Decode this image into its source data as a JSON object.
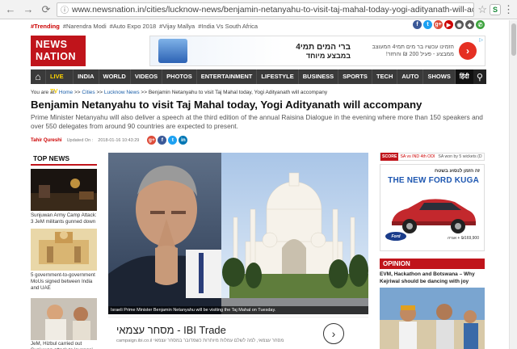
{
  "browser": {
    "url": "www.newsnation.in/cities/lucknow-news/benjamin-netanyahu-to-visit-taj-mahal-today-yogi-adityanath-will-accompany-arti...",
    "ext_label": "S"
  },
  "trending": {
    "label": "#Trending",
    "items": [
      "#Narendra Modi",
      "#Auto Expo 2018",
      "#Vijay Mallya",
      "#India Vs South Africa"
    ]
  },
  "social": [
    {
      "glyph": "f",
      "color": "#3b5998",
      "name": "facebook-icon"
    },
    {
      "glyph": "t",
      "color": "#1da1f2",
      "name": "twitter-icon"
    },
    {
      "glyph": "g+",
      "color": "#dd4b39",
      "name": "google-plus-icon"
    },
    {
      "glyph": "▶",
      "color": "#cc0000",
      "name": "youtube-icon"
    },
    {
      "glyph": "◉",
      "color": "#555555",
      "name": "instagram-icon"
    },
    {
      "glyph": "◆",
      "color": "#5a5a5a",
      "name": "app-icon"
    },
    {
      "glyph": "✆",
      "color": "#3da33d",
      "name": "phone-icon"
    }
  ],
  "logo": {
    "line1": "NEWS",
    "line2": "NATION"
  },
  "top_ad": {
    "headline1": "ברי המים תמי4",
    "headline2": "במבצע מיוחד",
    "mid_text": "הזמינו עכשיו בר מים תמי4 המעוצב ממבצע - פעיל 200 ₪ והחזר!",
    "arrow": "›",
    "mark": "▷"
  },
  "nav": {
    "items": [
      "LIVE TV",
      "INDIA",
      "WORLD",
      "VIDEOS",
      "PHOTOS",
      "ENTERTAINMENT",
      "LIFESTYLE",
      "BUSINESS",
      "SPORTS",
      "TECH",
      "AUTO",
      "SHOWS",
      "हिंदी"
    ]
  },
  "breadcrumb": {
    "prefix": "You are at:",
    "parts": [
      "Home",
      "Cities",
      "Lucknow News",
      "Benjamin Netanyahu to visit Taj Mahal today, Yogi Adityanath will accompany"
    ],
    "sep": ">>"
  },
  "article": {
    "headline": "Benjamin Netanyahu to visit Taj Mahal today, Yogi Adityanath will accompany",
    "summary": "Prime Minister Netanyahu will also deliver a speech at the third edition of the annual Raisina Dialogue in the evening where more than 150 speakers and over 550 delegates from around 90 countries are expected to present.",
    "author": "Tahir Qureshi",
    "updated_label": "Updated On :",
    "updated": "2018-01-16 10:43:29",
    "share": [
      {
        "glyph": "g+",
        "color": "#dd4b39",
        "name": "share-google-plus-icon"
      },
      {
        "glyph": "f",
        "color": "#3b5998",
        "name": "share-facebook-icon"
      },
      {
        "glyph": "t",
        "color": "#1da1f2",
        "name": "share-twitter-icon"
      },
      {
        "glyph": "in",
        "color": "#0077b5",
        "name": "share-linkedin-icon"
      }
    ],
    "hero_caption": "Israeli Prime Minister Benjamin Netanyahu will be visiting the Taj Mahal on Tuesday."
  },
  "top_news": {
    "heading": "TOP NEWS",
    "items": [
      "Sunjuwan Army Camp Attack: 3 JeM militants gunned down",
      "5 government-to-government MoUs signed between India and UAE",
      "JeM, Hizbul carried out Sunjuwan attack to 'avenge'"
    ]
  },
  "ibi_ad": {
    "title": "מסחר עצמאי - IBI Trade",
    "sub": "campaign.ibi.co.il  מסחר עצמאי, למה לשלם עמלות מיותרות כשמדובר במסחר עצמאי",
    "arrow": "›"
  },
  "score": {
    "tag": "SCORE",
    "team1": "SA vs IND 4th ODI",
    "team2": "SA won by 5 wickets (D"
  },
  "ford_ad": {
    "top": "זה הזמן לנסוע בשטח",
    "title": "THE NEW FORD KUGA",
    "logo": "Ford",
    "price": "₪169,900 + אגרה"
  },
  "opinion": {
    "heading": "OPINION",
    "title": "EVM, Hackathon and Botswana – Why Kejriwal should be dancing with joy"
  }
}
